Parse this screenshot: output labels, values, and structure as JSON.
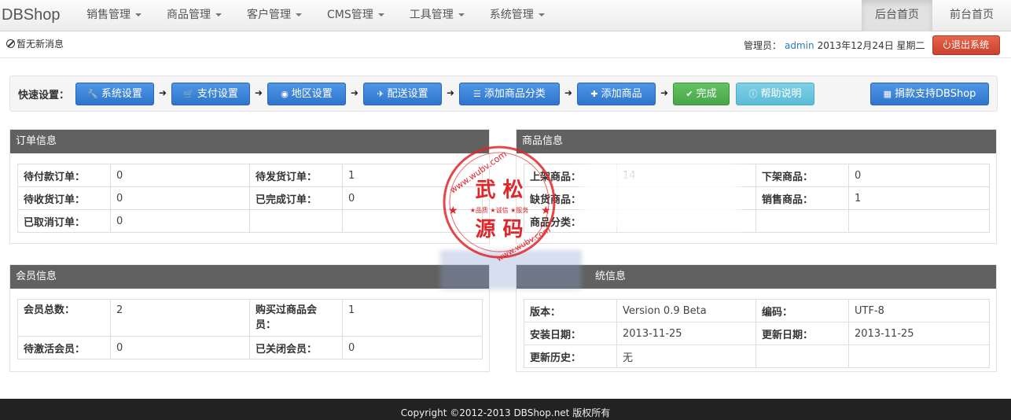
{
  "navbar": {
    "brand": "DBShop",
    "menus": [
      "销售管理",
      "商品管理",
      "客户管理",
      "CMS管理",
      "工具管理",
      "系统管理"
    ],
    "right_tabs": [
      "后台首页",
      "前台首页"
    ]
  },
  "status": {
    "notice": "暂无新消息",
    "admin_label": "管理员：",
    "admin_name": "admin",
    "date": "2013年12月24日 星期二",
    "logout": "退出系统"
  },
  "quick": {
    "label": "快速设置：",
    "steps": [
      {
        "label": "系统设置",
        "icon": "wrench-icon"
      },
      {
        "label": "支付设置",
        "icon": "cart-icon"
      },
      {
        "label": "地区设置",
        "icon": "globe-icon"
      },
      {
        "label": "配送设置",
        "icon": "plane-icon"
      },
      {
        "label": "添加商品分类",
        "icon": "list-icon"
      },
      {
        "label": "添加商品",
        "icon": "plus-icon"
      },
      {
        "label": "完成",
        "icon": "check-icon"
      },
      {
        "label": "帮助说明",
        "icon": "info-icon"
      }
    ],
    "donate": "捐款支持DBShop"
  },
  "order_panel": {
    "title": "订单信息",
    "rows": [
      [
        "待付款订单：",
        "0",
        "待发货订单：",
        "1"
      ],
      [
        "待收货订单：",
        "0",
        "已完成订单：",
        "0"
      ],
      [
        "已取消订单：",
        "0",
        "",
        ""
      ]
    ]
  },
  "goods_panel": {
    "title": "商品信息",
    "rows": [
      [
        "上架商品：",
        "14",
        "下架商品：",
        "0"
      ],
      [
        "缺货商品：",
        "",
        "销售商品：",
        "1"
      ],
      [
        "商品分类：",
        "",
        "",
        ""
      ]
    ]
  },
  "member_panel": {
    "title": "会员信息",
    "rows": [
      [
        "会员总数：",
        "2",
        "购买过商品会员：",
        "1"
      ],
      [
        "待激活会员：",
        "0",
        "已关闭会员：",
        "0"
      ]
    ]
  },
  "system_panel": {
    "title": "统信息",
    "rows": [
      [
        "版本：",
        "Version 0.9 Beta",
        "编码：",
        "UTF-8"
      ],
      [
        "安装日期：",
        "2013-11-25",
        "更新日期：",
        "2013-11-25"
      ],
      [
        "更新历史：",
        "无",
        "",
        ""
      ]
    ]
  },
  "watermark": {
    "url_top": "www.wubv.com",
    "name_top": "武 松",
    "slogan": "★品质 ★诚信 ★服务",
    "name_bottom": "源 码",
    "url_bottom": "www.wubv.com"
  },
  "footer": {
    "copyright": "Copyright ©2012-2013 DBShop.net 版权所有"
  },
  "colors": {
    "primary": "#3578d4",
    "success": "#51a751",
    "info": "#6cc6de",
    "danger": "#d24e36",
    "panel_head": "#616161",
    "stamp": "#e0262a"
  }
}
